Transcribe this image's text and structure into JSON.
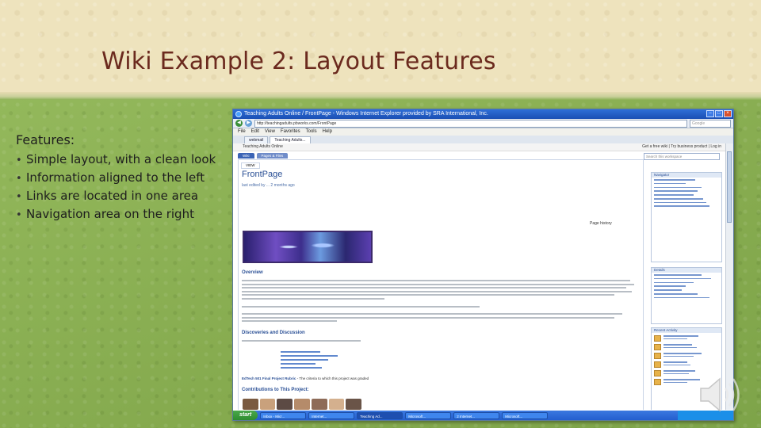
{
  "slide": {
    "title": "Wiki Example 2: Layout Features",
    "features_heading": "Features:",
    "features": [
      "Simple layout, with a clean look",
      "Information aligned to the left",
      "Links are located in one area",
      "Navigation area on the right"
    ]
  },
  "browser": {
    "window_title": "Teaching Adults Online / FrontPage - Windows Internet Explorer provided by SRA International, Inc.",
    "address": "http://teachingadults.pbworks.com/FrontPage",
    "search_placeholder": "Google",
    "menu": [
      "File",
      "Edit",
      "View",
      "Favorites",
      "Tools",
      "Help"
    ],
    "tabs": [
      "webmail",
      "Teaching Adults..."
    ]
  },
  "wiki": {
    "site_name": "Teaching Adults Online",
    "top_right": "Get a free wiki | Try business product | Log in",
    "nav_tabs": [
      "Wiki",
      "Pages & Files"
    ],
    "search_placeholder": "Search this workspace",
    "page_tab": "VIEW",
    "page_title": "FrontPage",
    "breadcrumb": "last edited by ... 2 months ago",
    "page_action": "Page history",
    "sections": {
      "overview": "Overview",
      "discoveries": "Discoveries and Discussion",
      "rubric_label": "EdTech 501 Final Project Rubric",
      "rubric_text": " - The criteria to which this project was graded",
      "contributions": "Contributions to This Project:"
    },
    "sidebar": {
      "navigator": "Navigator",
      "details": "Details",
      "recent_activity": "Recent Activity"
    }
  },
  "taskbar": {
    "start": "start",
    "items": [
      "Inbox - Micr...",
      "Internet...",
      "Teaching Ad...",
      "Microsoft...",
      "2 Internet...",
      "Microsoft..."
    ]
  }
}
